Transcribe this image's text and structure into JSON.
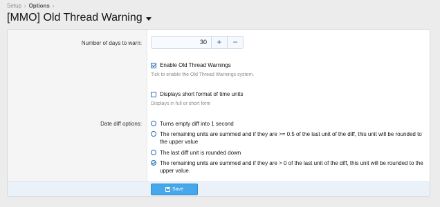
{
  "breadcrumb": {
    "items": [
      "Setup",
      "Options"
    ]
  },
  "page": {
    "title": "[MMO] Old Thread Warning"
  },
  "form": {
    "days": {
      "label": "Number of days to warn:",
      "value": "30",
      "plus": "+",
      "minus": "−"
    },
    "enable": {
      "label": "Enable Old Thread Warnings",
      "hint": "Tick to enable the Old Thread Warnings system.",
      "checked": true
    },
    "short_format": {
      "label": "Displays short format of time units",
      "hint": "Displays in full or short form",
      "checked": false
    },
    "date_diff": {
      "label": "Date diff options:",
      "options": [
        {
          "text": "Turns empty diff into 1 second",
          "selected": false
        },
        {
          "text": "The remaining units are summed and if they are >= 0.5 of the last unit of the diff, this unit will be rounded to the upper value",
          "selected": false
        },
        {
          "text": "The last diff unit is rounded down",
          "selected": false
        },
        {
          "text": "The remaining units are summed and if they are > 0 of the last unit of the diff, this unit will be rounded to the upper value.",
          "selected": true
        }
      ]
    }
  },
  "footer": {
    "save_label": "Save"
  }
}
